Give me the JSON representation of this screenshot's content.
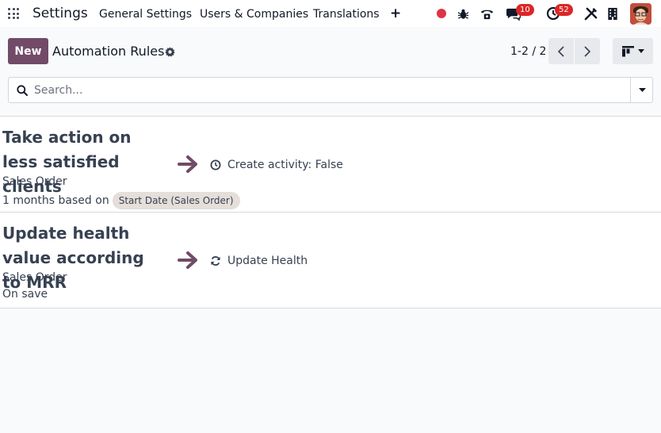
{
  "navbar": {
    "brand": "Settings",
    "menu": [
      "General Settings",
      "Users & Companies",
      "Translations"
    ],
    "plus": "+",
    "badges": {
      "chat": "10",
      "activities": "52"
    }
  },
  "control_panel": {
    "new_label": "New",
    "title": "Automation Rules",
    "pager": "1-2 / 2"
  },
  "search": {
    "placeholder": "Search..."
  },
  "rules": [
    {
      "name": "Take action on less satisfied clients",
      "model": "Sales Order",
      "trigger_prefix": "1 months based on",
      "trigger_field": "Start Date (Sales Order)",
      "action_icon": "clock-icon",
      "action": "Create activity: False"
    },
    {
      "name": "Update health value according to MRR",
      "model": "Sales Order",
      "trigger_prefix": "On save",
      "action_icon": "refresh-icon",
      "action": "Update Health"
    }
  ],
  "colors": {
    "primary": "#714b67",
    "badge": "#dc2626",
    "record": "#dc3545"
  }
}
